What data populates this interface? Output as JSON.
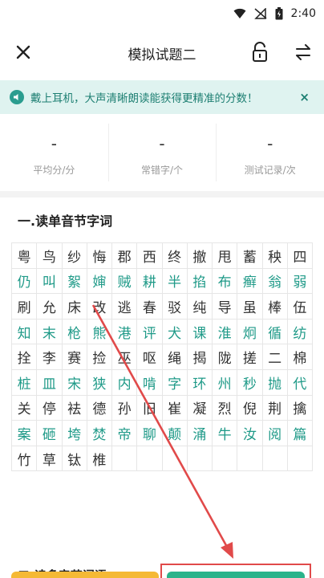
{
  "status": {
    "time": "2:40"
  },
  "header": {
    "title": "模拟试题二"
  },
  "notice": {
    "text": "戴上耳机，大声清晰朗读能获得更精准的分数！"
  },
  "stats": [
    {
      "value": "-",
      "label": "平均分/分"
    },
    {
      "value": "-",
      "label": "常错字/个"
    },
    {
      "value": "-",
      "label": "测试记录/次"
    }
  ],
  "section1": {
    "title": "一.读单音节字词"
  },
  "rows": [
    {
      "color": "dark",
      "chars": [
        "粤",
        "鸟",
        "纱",
        "悔",
        "郡",
        "西",
        "终",
        "撤",
        "甩",
        "蓄",
        "秧",
        "四"
      ]
    },
    {
      "color": "green",
      "chars": [
        "仍",
        "叫",
        "絮",
        "婶",
        "贼",
        "耕",
        "半",
        "掐",
        "布",
        "癣",
        "翁",
        "弱"
      ]
    },
    {
      "color": "dark",
      "chars": [
        "刷",
        "允",
        "床",
        "改",
        "逃",
        "春",
        "驳",
        "纯",
        "导",
        "虽",
        "棒",
        "伍"
      ]
    },
    {
      "color": "green",
      "chars": [
        "知",
        "末",
        "枪",
        "熊",
        "港",
        "评",
        "犬",
        "课",
        "淮",
        "炯",
        "循",
        "纺"
      ]
    },
    {
      "color": "dark",
      "chars": [
        "拴",
        "李",
        "赛",
        "捡",
        "巫",
        "呕",
        "绳",
        "揭",
        "陇",
        "搓",
        "二",
        "棉"
      ]
    },
    {
      "color": "green",
      "chars": [
        "桩",
        "皿",
        "宋",
        "狭",
        "内",
        "啃",
        "字",
        "环",
        "州",
        "秒",
        "抛",
        "代"
      ]
    },
    {
      "color": "dark",
      "chars": [
        "关",
        "停",
        "袪",
        "德",
        "孙",
        "旧",
        "崔",
        "凝",
        "烈",
        "倪",
        "荆",
        "擒"
      ]
    },
    {
      "color": "green",
      "chars": [
        "案",
        "砸",
        "垮",
        "焚",
        "帝",
        "聊",
        "颠",
        "涌",
        "牛",
        "汝",
        "阅",
        "篇"
      ]
    },
    {
      "color": "dark",
      "chars": [
        "竹",
        "草",
        "钛",
        "椎"
      ]
    }
  ],
  "section2": {
    "title": "二.读多音节词语"
  }
}
